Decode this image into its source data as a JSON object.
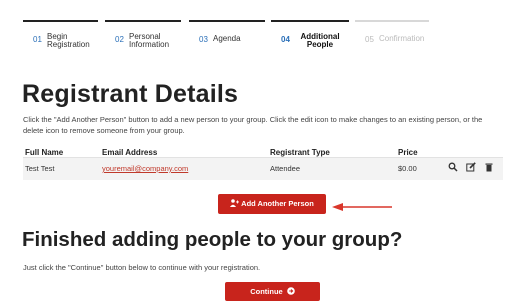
{
  "steps": [
    {
      "num": "01",
      "label": "Begin Registration",
      "state": "done"
    },
    {
      "num": "02",
      "label": "Personal Information",
      "state": "done"
    },
    {
      "num": "03",
      "label": "Agenda",
      "state": "done"
    },
    {
      "num": "04",
      "label": "Additional People",
      "state": "active"
    },
    {
      "num": "05",
      "label": "Confirmation",
      "state": "inactive"
    }
  ],
  "title": "Registrant Details",
  "intro": "Click the \"Add Another Person\" button to add a new person to your group. Click the edit icon to make changes to an existing person, or the delete icon to remove someone from your group.",
  "table": {
    "headers": {
      "name": "Full Name",
      "email": "Email Address",
      "type": "Registrant Type",
      "price": "Price"
    },
    "rows": [
      {
        "name": "Test Test",
        "email": "youremail@company.com",
        "type": "Attendee",
        "price": "$0.00"
      }
    ]
  },
  "add_button": {
    "label": "Add Another Person",
    "icon": "user-plus-icon"
  },
  "section2_title": "Finished adding people to your group?",
  "section2_note": "Just click the \"Continue\" button below to continue with your registration.",
  "continue_button": {
    "label": "Continue",
    "icon": "arrow-circle-right-icon"
  },
  "colors": {
    "accent": "#c8241c",
    "arrow": "#d9362b",
    "step_num": "#2a6fb8"
  }
}
